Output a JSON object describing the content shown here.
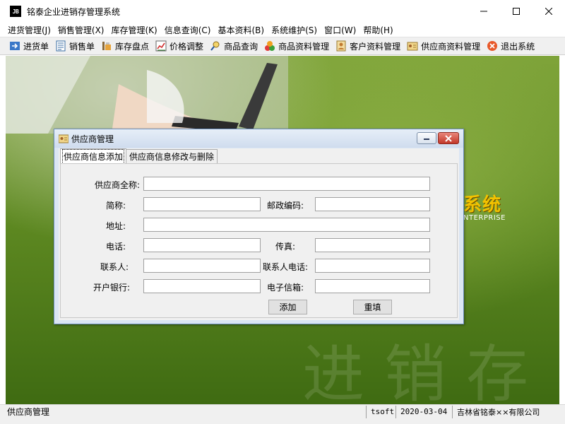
{
  "window": {
    "app_icon_text": "JB",
    "title": "铭泰企业进销存管理系统",
    "controls": [
      "minimize-icon",
      "maximize-icon",
      "close-icon"
    ]
  },
  "menubar": {
    "items": [
      "进货管理(J)",
      "销售管理(X)",
      "库存管理(K)",
      "信息查询(C)",
      "基本资料(B)",
      "系统维护(S)",
      "窗口(W)",
      "帮助(H)"
    ]
  },
  "toolbar": {
    "items": [
      {
        "label": "进货单",
        "icon": "purchase-order-icon"
      },
      {
        "label": "销售单",
        "icon": "sales-order-icon"
      },
      {
        "label": "库存盘点",
        "icon": "inventory-count-icon"
      },
      {
        "label": "价格调整",
        "icon": "price-adjust-icon"
      },
      {
        "label": "商品查询",
        "icon": "product-search-icon"
      },
      {
        "label": "商品资料管理",
        "icon": "product-data-icon"
      },
      {
        "label": "客户资料管理",
        "icon": "customer-data-icon"
      },
      {
        "label": "供应商资料管理",
        "icon": "supplier-data-icon"
      },
      {
        "label": "退出系统",
        "icon": "exit-icon"
      }
    ]
  },
  "background": {
    "logo_title": "系统",
    "logo_subtitle": "NTERPRISE"
  },
  "dialog": {
    "title": "供应商管理",
    "tabs": [
      "供应商信息添加",
      "供应商信息修改与删除"
    ],
    "active_tab": 0,
    "form": {
      "full_name_label": "供应商全称:",
      "short_name_label": "简称:",
      "postcode_label": "邮政编码:",
      "address_label": "地址:",
      "phone_label": "电话:",
      "fax_label": "传真:",
      "contact_label": "联系人:",
      "contact_phone_label": "联系人电话:",
      "bank_label": "开户银行:",
      "email_label": "电子信箱:",
      "values": {
        "full_name": "",
        "short_name": "",
        "postcode": "",
        "address": "",
        "phone": "",
        "fax": "",
        "contact": "",
        "contact_phone": "",
        "bank": "",
        "email": ""
      }
    },
    "add_button": "添加",
    "reset_button": "重填"
  },
  "statusbar": {
    "current": "供应商管理",
    "user": "tsoft",
    "date": "2020-03-04",
    "company": "吉林省铭泰××有限公司"
  }
}
